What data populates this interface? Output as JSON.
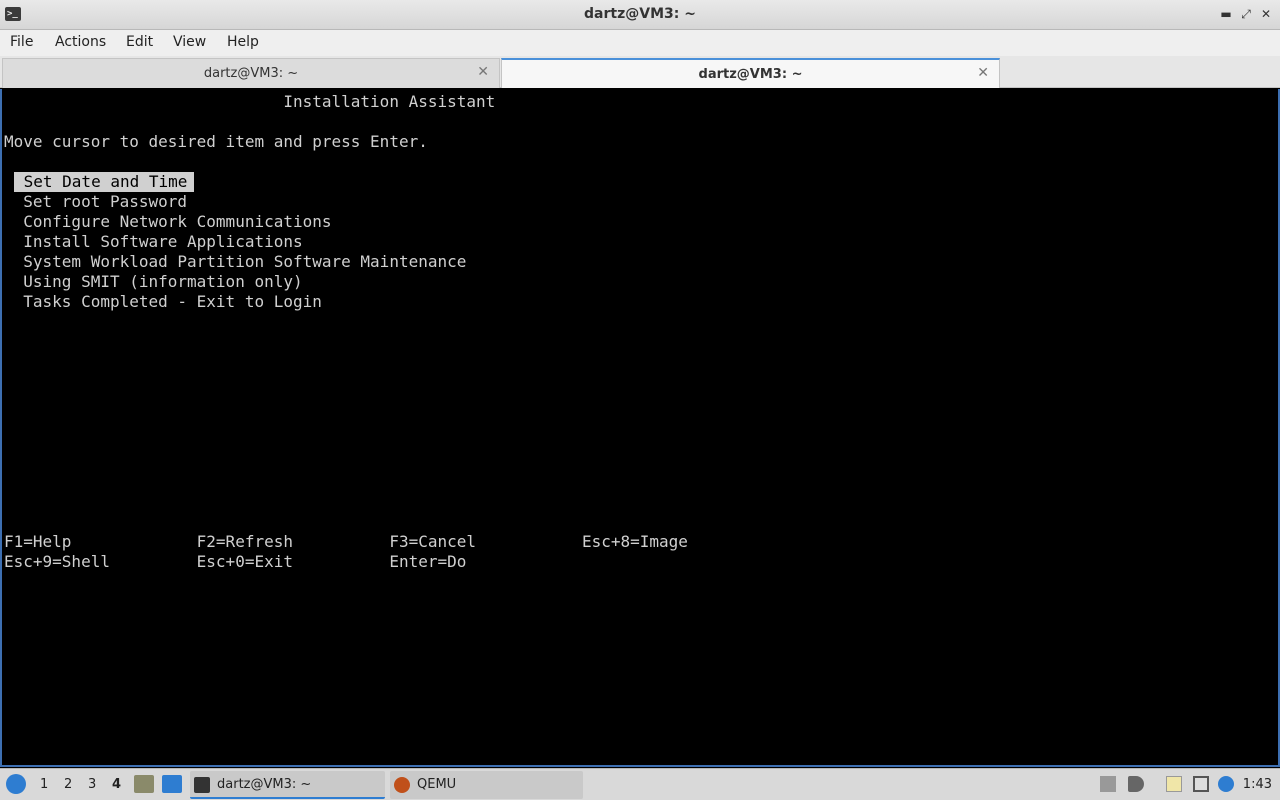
{
  "window": {
    "title": "dartz@VM3: ~",
    "app_icon_glyph": ">_",
    "minimize_glyph": "▬",
    "maximize_glyph": "⤢",
    "close_glyph": "✕"
  },
  "menu": [
    "File",
    "Actions",
    "Edit",
    "View",
    "Help"
  ],
  "tabs": [
    {
      "label": "dartz@VM3: ~",
      "close": "✕",
      "active": false
    },
    {
      "label": "dartz@VM3: ~",
      "close": "✕",
      "active": true
    }
  ],
  "terminal": {
    "header": "                             Installation Assistant",
    "instruction": "Move cursor to desired item and press Enter.",
    "items": [
      " Set Date and Time",
      "  Set root Password",
      "  Configure Network Communications",
      "  Install Software Applications",
      "  System Workload Partition Software Maintenance",
      "  Using SMIT (information only)",
      "  Tasks Completed - Exit to Login"
    ],
    "keys_row1": "F1=Help             F2=Refresh          F3=Cancel           Esc+8=Image",
    "keys_row2": "Esc+9=Shell         Esc+0=Exit          Enter=Do"
  },
  "taskbar": {
    "workspaces": [
      "1",
      "2",
      "3",
      "4"
    ],
    "current_workspace": "4",
    "tasks": [
      {
        "label": "dartz@VM3: ~",
        "icon": "terminal-icon",
        "active": true
      },
      {
        "label": "QEMU",
        "icon": "qemu-icon",
        "active": false
      }
    ],
    "clock": "1:43"
  },
  "colors": {
    "terminal_bg": "#000000",
    "terminal_fg": "#d0d0d0",
    "accent": "#2e7dd1"
  }
}
